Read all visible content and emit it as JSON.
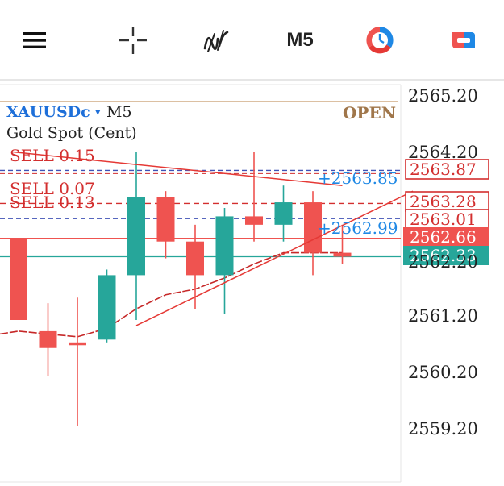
{
  "toolbar": {
    "menu_icon": "menu-icon",
    "crosshair_icon": "crosshair-icon",
    "indicators_icon": "indicators-icon",
    "timeframe_label": "M5",
    "history_icon": "history-clock-icon",
    "trade_icon": "trade-icon"
  },
  "chart_header": {
    "symbol": "XAUUSDc",
    "dropdown_glyph": "▾",
    "timeframe": "M5",
    "description": "Gold Spot (Cent)",
    "market_status": "OPEN"
  },
  "colors": {
    "bull": "#26a69a",
    "bear": "#ef5350",
    "order_line": "#d32f2f",
    "blue_line": "#3f51b5",
    "profit_text": "#1e88e5",
    "open_label": "#a0764a",
    "bid_line": "#26a69a",
    "ask_line": "#ef5350"
  },
  "orders": [
    {
      "label": "SELL 0.15",
      "price": 2563.87
    },
    {
      "label": "SELL 0.07",
      "price": 2563.28
    },
    {
      "label": "SELL 0.13",
      "price": 2563.01
    }
  ],
  "order_profits": [
    {
      "text": "+2563.85",
      "price": 2563.87
    },
    {
      "text": "+2562.99",
      "price": 2562.99
    }
  ],
  "price_tags": [
    {
      "text": "2563.87",
      "price": 2563.87,
      "style": "outline"
    },
    {
      "text": "2563.28",
      "price": 2563.28,
      "style": "outline"
    },
    {
      "text": "2563.01",
      "price": 2563.01,
      "style": "outline"
    },
    {
      "text": "2562.66",
      "price": 2562.66,
      "style": "ask"
    },
    {
      "text": "2562.33",
      "price": 2562.33,
      "style": "bid"
    }
  ],
  "chart_data": {
    "type": "candlestick",
    "symbol": "XAUUSDc",
    "timeframe": "M5",
    "y_ticks": [
      "2565.20",
      "2564.20",
      "2561.20",
      "2560.20",
      "2559.20"
    ],
    "y_tick_values": [
      2565.2,
      2564.2,
      2561.2,
      2560.2,
      2559.2
    ],
    "ylim": [
      2558.3,
      2565.5
    ],
    "candles": [
      {
        "open": 2562.66,
        "high": 2562.66,
        "low": 2561.2,
        "close": 2561.2
      },
      {
        "open": 2561.0,
        "high": 2561.5,
        "low": 2560.2,
        "close": 2560.7
      },
      {
        "open": 2560.8,
        "high": 2561.6,
        "low": 2559.3,
        "close": 2560.75
      },
      {
        "open": 2560.85,
        "high": 2562.1,
        "low": 2560.8,
        "close": 2562.0
      },
      {
        "open": 2562.0,
        "high": 2564.2,
        "low": 2561.2,
        "close": 2563.4
      },
      {
        "open": 2563.4,
        "high": 2563.5,
        "low": 2562.3,
        "close": 2562.6
      },
      {
        "open": 2562.6,
        "high": 2562.9,
        "low": 2561.4,
        "close": 2562.0
      },
      {
        "open": 2562.0,
        "high": 2563.2,
        "low": 2561.3,
        "close": 2563.05
      },
      {
        "open": 2563.05,
        "high": 2564.2,
        "low": 2562.6,
        "close": 2562.9
      },
      {
        "open": 2562.9,
        "high": 2563.6,
        "low": 2562.6,
        "close": 2563.3
      },
      {
        "open": 2563.3,
        "high": 2563.5,
        "low": 2562.0,
        "close": 2562.4
      },
      {
        "open": 2562.4,
        "high": 2562.9,
        "low": 2562.2,
        "close": 2562.33
      }
    ],
    "moving_average": [
      2561.0,
      2560.95,
      2560.9,
      2561.05,
      2561.4,
      2561.65,
      2561.75,
      2561.95,
      2562.2,
      2562.4,
      2562.4,
      2562.4
    ],
    "trendlines": [
      {
        "from": [
          4,
          2561.1
        ],
        "to": [
          13.4,
          2563.5
        ]
      },
      {
        "from": [
          -0.2,
          2564.2
        ],
        "to": [
          11.0,
          2563.6
        ]
      }
    ],
    "grid": false
  }
}
